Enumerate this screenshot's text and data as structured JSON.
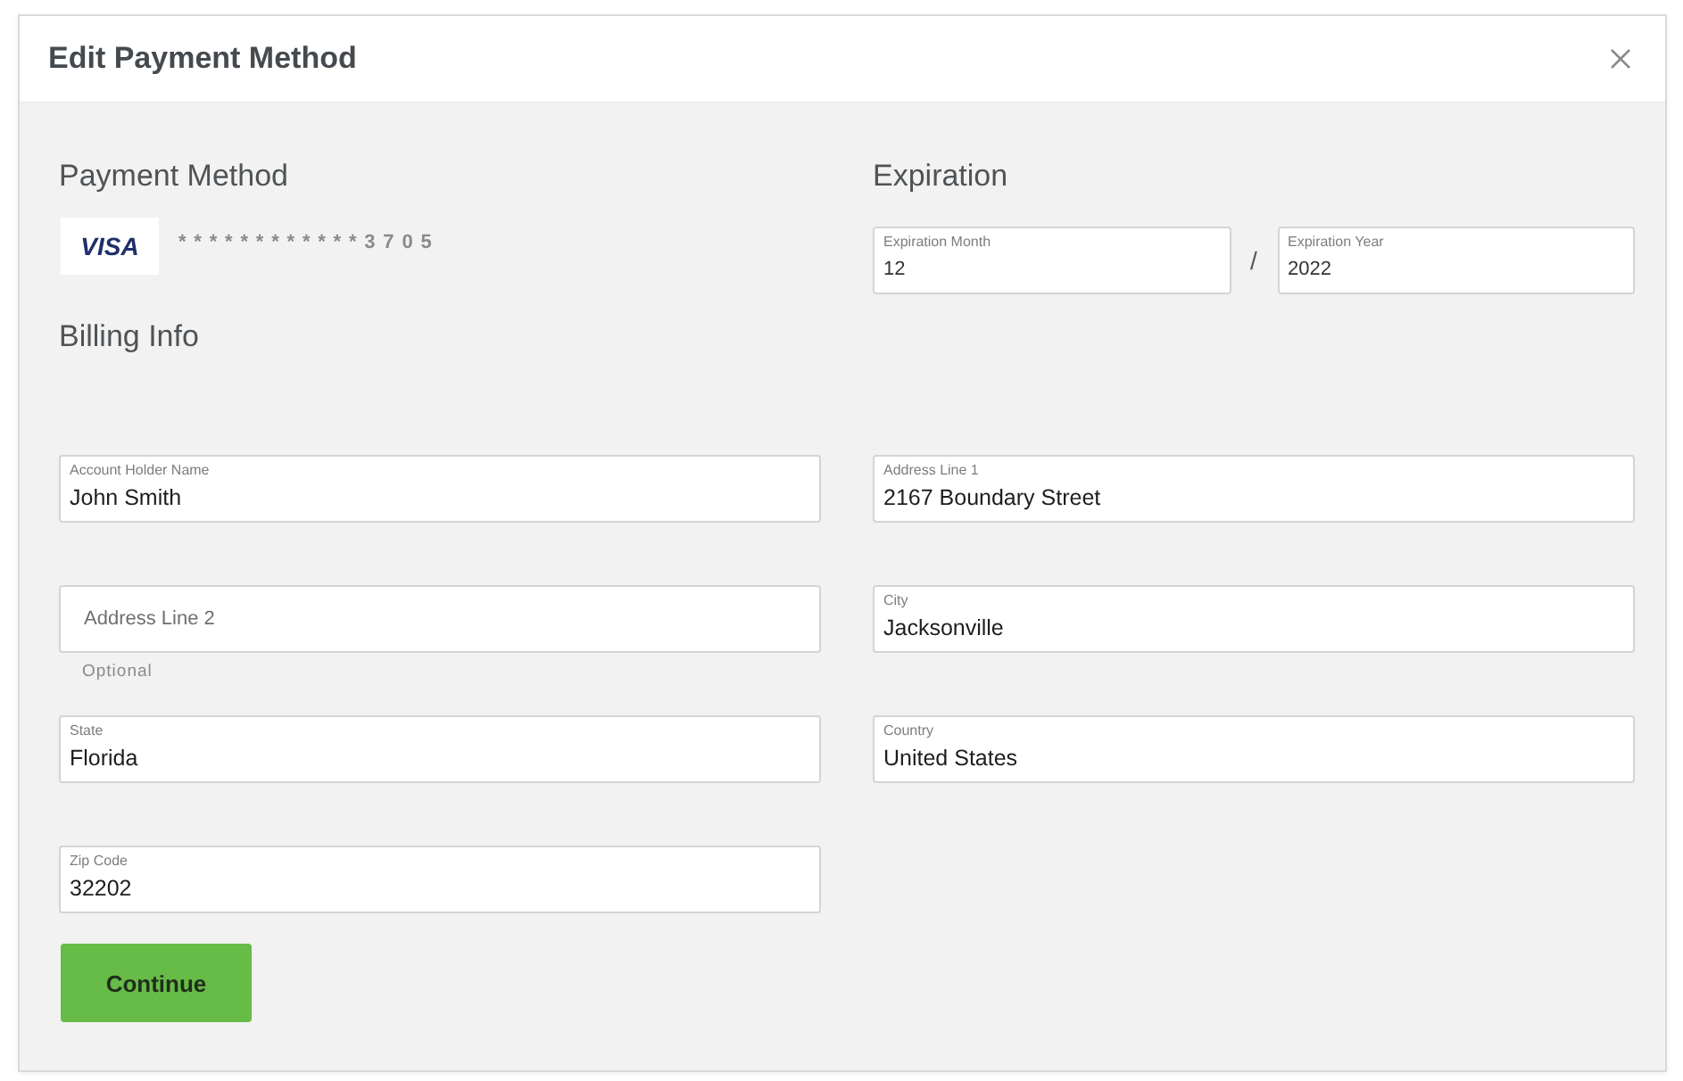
{
  "dialog": {
    "title": "Edit Payment Method"
  },
  "payment_method": {
    "heading": "Payment Method",
    "card_brand": "VISA",
    "card_number": "************3705"
  },
  "expiration": {
    "heading": "Expiration",
    "separator": "/",
    "fields": [
      {
        "label": "Expiration Month",
        "value": "12"
      },
      {
        "label": "Expiration Year",
        "value": "2022"
      }
    ]
  },
  "billing_info": {
    "heading": "Billing Info",
    "fields": [
      {
        "label": "Account Holder Name",
        "value": "John Smith"
      },
      {
        "label": "Address Line 1",
        "value": "2167 Boundary Street"
      },
      {
        "placeholder": "Address Line 2",
        "helper": "Optional"
      },
      {
        "label": "City",
        "value": "Jacksonville"
      },
      {
        "label": "State",
        "value": "Florida"
      },
      {
        "label": "Country",
        "value": "United States"
      },
      {
        "label": "Zip Code",
        "value": "32202"
      }
    ]
  },
  "continue_button": {
    "label": "Continue"
  }
}
